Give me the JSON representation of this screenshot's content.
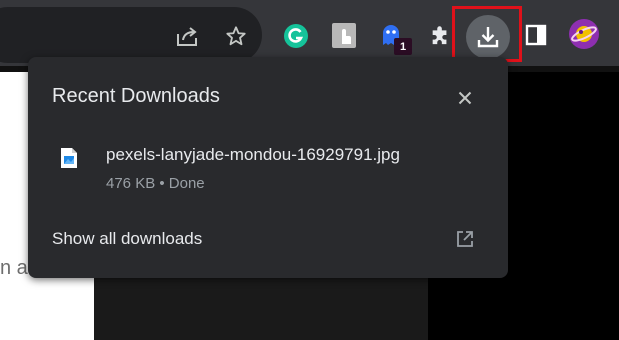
{
  "toolbar": {
    "icons": [
      "share-icon",
      "bookmark-star-icon",
      "grammarly-extension-icon",
      "touch-extension-icon",
      "ghostery-extension-icon",
      "extensions-puzzle-icon",
      "download-icon",
      "side-panel-icon",
      "profile-avatar"
    ],
    "ghostery_badge": "1"
  },
  "downloads": {
    "title": "Recent Downloads",
    "items": [
      {
        "name": "pexels-lanyjade-mondou-16929791.jpg",
        "status": "476 KB • Done",
        "icon": "image-file-icon"
      }
    ],
    "show_all": "Show all downloads"
  },
  "page": {
    "partial_text": "n a"
  },
  "colors": {
    "toolbar_bg": "#35363a",
    "bubble_bg": "#292a2d",
    "highlight": "#e0111a",
    "grammarly": "#15c39a",
    "ghostery": "#2f6ff2"
  }
}
